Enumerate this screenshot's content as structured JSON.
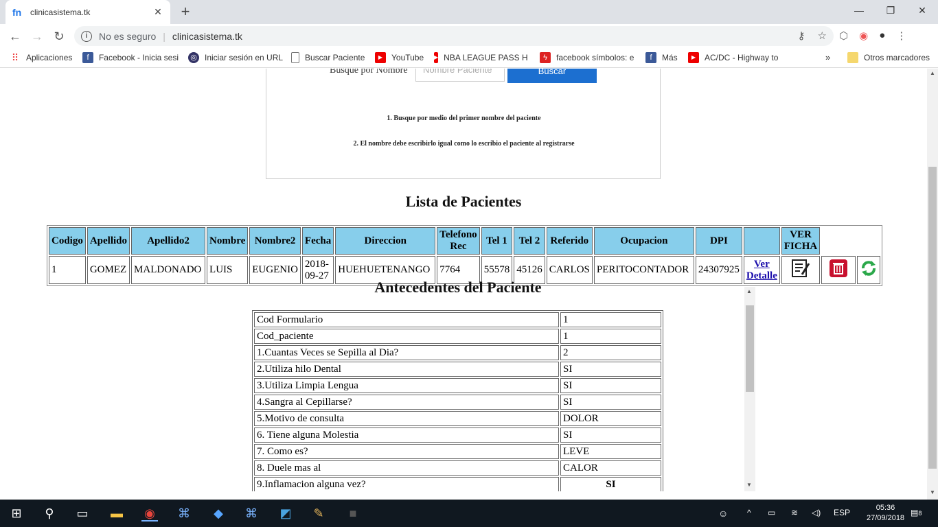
{
  "browser": {
    "tab_title": "clinicasistema.tk",
    "security": "No es seguro",
    "url": "clinicasistema.tk"
  },
  "bookmarks": [
    {
      "label": "Aplicaciones",
      "icon": "apps-grid-icon"
    },
    {
      "label": "Facebook - Inicia sesi",
      "icon": "facebook-icon"
    },
    {
      "label": "Iniciar sesión en URL",
      "icon": "globe-icon"
    },
    {
      "label": "Buscar Paciente",
      "icon": "page-icon"
    },
    {
      "label": "YouTube",
      "icon": "youtube-icon"
    },
    {
      "label": "NBA LEAGUE PASS H",
      "icon": "youtube-icon"
    },
    {
      "label": "facebook símbolos: e",
      "icon": "bolt-icon"
    },
    {
      "label": "Más",
      "icon": "facebook-icon"
    },
    {
      "label": "AC/DC - Highway to",
      "icon": "youtube-icon"
    },
    {
      "label": "Otros marcadores",
      "icon": "folder-icon"
    }
  ],
  "search": {
    "label": "Busque por Nombre",
    "placeholder": "Nombre Paciente",
    "button": "Buscar",
    "note1": "1. Busque por medio del primer nombre del paciente",
    "note2": "2. El nombre debe escribirlo igual como lo escribio el paciente al registrarse"
  },
  "patients": {
    "title": "Lista de Pacientes",
    "headers": [
      "Codigo",
      "Apellido",
      "Apellido2",
      "Nombre",
      "Nombre2",
      "Fecha",
      "Direccion",
      "Telefono Rec",
      "Tel 1",
      "Tel 2",
      "Referido",
      "Ocupacion",
      "DPI",
      "",
      "VER FICHA"
    ],
    "row": {
      "codigo": "1",
      "apellido": "GOMEZ",
      "apellido2": "MALDONADO",
      "nombre": "LUIS",
      "nombre2": "EUGENIO",
      "fecha": "2018-09-27",
      "direccion": "HUEHUETENANGO",
      "telefono_rec": "7764",
      "tel1": "55578",
      "tel2": "45126",
      "referido": "CARLOS",
      "ocupacion": "PERITOCONTADOR",
      "dpi": "24307925",
      "link": "Ver Detalle"
    }
  },
  "antecedentes": {
    "title": "Antecedentes del Paciente",
    "rows": [
      {
        "q": "Cod Formulario",
        "a": "1"
      },
      {
        "q": "Cod_paciente",
        "a": "1"
      },
      {
        "q": "1.Cuantas Veces se Sepilla al Dia?",
        "a": "2"
      },
      {
        "q": "2.Utiliza hilo Dental",
        "a": "SI"
      },
      {
        "q": "3.Utiliza Limpia Lengua",
        "a": "SI"
      },
      {
        "q": "4.Sangra al Cepillarse?",
        "a": "SI"
      },
      {
        "q": "5.Motivo de consulta",
        "a": "DOLOR"
      },
      {
        "q": "6. Tiene alguna Molestia",
        "a": "SI"
      },
      {
        "q": "7. Como es?",
        "a": "LEVE"
      },
      {
        "q": "8. Duele mas al",
        "a": "CALOR"
      },
      {
        "q": "9.Inflamacion alguna vez?",
        "a": "SI"
      }
    ]
  },
  "taskbar": {
    "language": "ESP",
    "time": "05:36",
    "date": "27/09/2018",
    "notifications": "8"
  }
}
